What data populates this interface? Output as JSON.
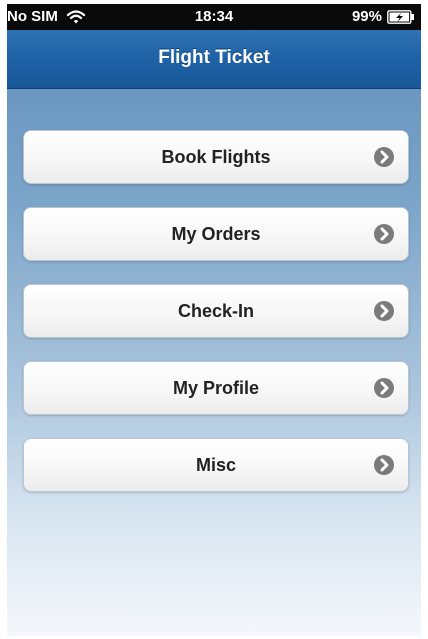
{
  "status_bar": {
    "carrier": "No SIM",
    "time": "18:34",
    "battery": "99%"
  },
  "nav": {
    "title": "Flight Ticket"
  },
  "menu": {
    "items": [
      {
        "label": "Book Flights"
      },
      {
        "label": "My Orders"
      },
      {
        "label": "Check-In"
      },
      {
        "label": "My Profile"
      },
      {
        "label": "Misc"
      }
    ]
  },
  "icons": {
    "wifi": "wifi-icon",
    "battery": "battery-charging-icon",
    "chevron": "chevron-right-icon"
  },
  "colors": {
    "nav_bar": "#1e62a6",
    "status_bar": "#0a0a0a",
    "chevron": "#7b7b7b"
  }
}
